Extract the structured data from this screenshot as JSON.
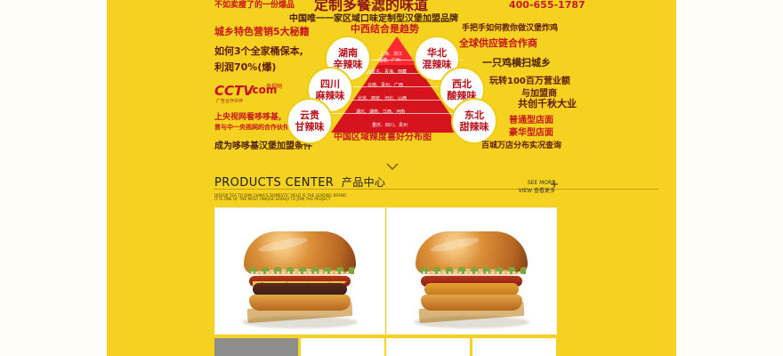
{
  "top_banner": {
    "left_partial": "不如卖瘦了的一份爆品",
    "headline_partial": "定制多餐滤的味道",
    "phone": "400-655-1787",
    "subtitle": "中国唯一一家区域口味定制型汉堡加盟品牌",
    "left_lines": [
      "城乡特色营销5大秘籍",
      "如何3个全家桶保本,",
      "利润70%(爆)",
      "上央视网看哆哆基,",
      "曾与中一央视网的合作伙伴",
      "成为哆哆基汉堡加盟条件"
    ],
    "cctv": {
      "mark": "CCTV",
      "dot_com": ".com",
      "side_label": "央视网",
      "caption": "广告合作伙伴"
    },
    "pyramid": {
      "title": "中西结合是趋势",
      "rows": [
        "上海、浙江",
        "福建、广州",
        "内蒙古、青海、西藏",
        "云南、贵州、广西",
        "北京、西安、河北、山西",
        "湖北、湖南、江西、河南",
        "重庆、四川、贵州"
      ],
      "caption": "中国区域辣度喜好分布图"
    },
    "bubbles": [
      "湖南\n辛辣味",
      "四川\n麻辣味",
      "云贵\n甘辣味",
      "华北\n混辣味",
      "西北\n酸辣味",
      "东北\n甜辣味"
    ],
    "right_lines": [
      "手把手如何教你做汉堡炸鸡",
      "全球供应链合作商",
      "一只鸡横扫城乡",
      "玩转100百万营业额",
      "与加盟商",
      "共创千秋大业",
      "普通型店面",
      "豪华型店面",
      "百城万店分布实况查询"
    ]
  },
  "products": {
    "title_en": "PRODUCTS CENTER",
    "title_cn": "产品中心",
    "copy_line_1": "DODOJI TEA TO JOIN CHINA'S DOMESTIC YIELD IS THE LEADING BRAND",
    "copy_line_2": "IT IS ONE OF THE MOST UNIQUE DODOJI TO JOIN THE PROJECT",
    "see_more_1": "SEE MORE",
    "see_more_2": "VIEW 查看更多",
    "plus": "+"
  }
}
